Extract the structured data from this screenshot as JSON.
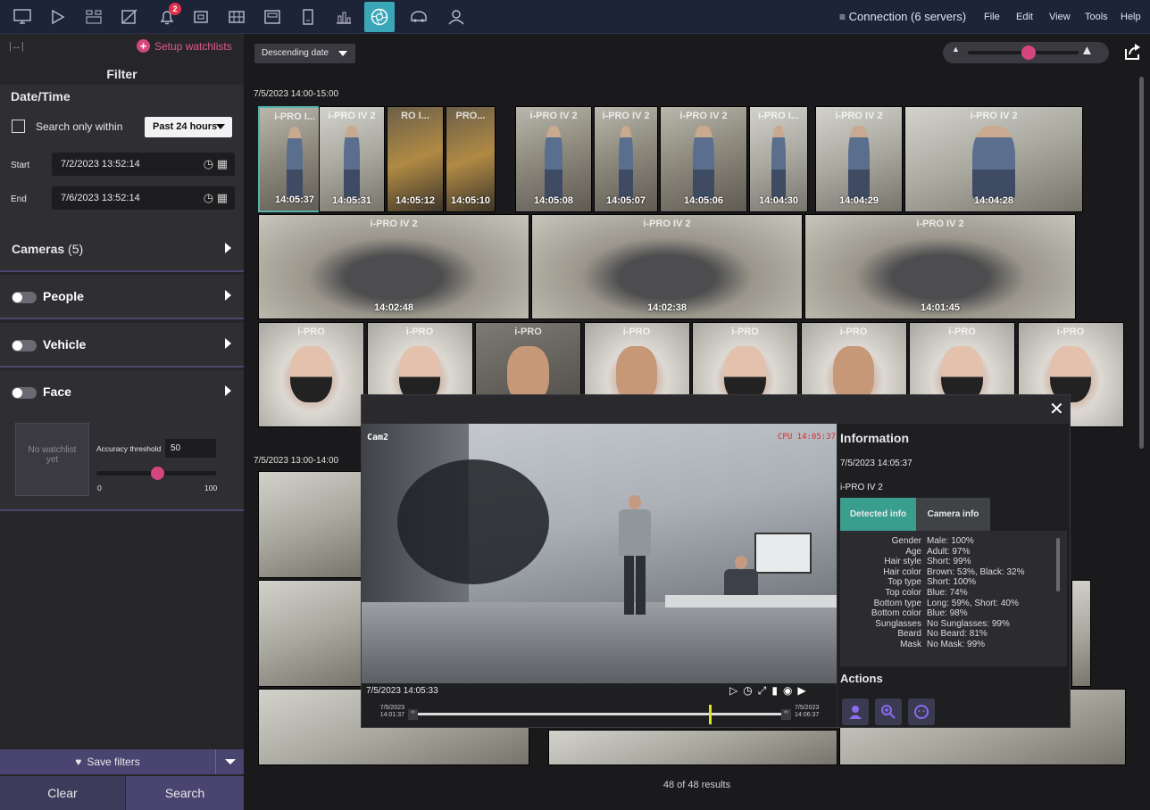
{
  "topbar": {
    "notification_count": "2",
    "connection": "Connection (6 servers)",
    "menus": [
      "File",
      "Edit",
      "View",
      "Tools",
      "Help"
    ]
  },
  "sidebar": {
    "setup_watchlists": "Setup watchlists",
    "filter_title": "Filter",
    "datetime_title": "Date/Time",
    "search_only_within": "Search only within",
    "range_option": "Past 24 hours",
    "start_label": "Start",
    "start_value": "7/2/2023 13:52:14",
    "end_label": "End",
    "end_value": "7/6/2023 13:52:14",
    "cameras_title": "Cameras",
    "cameras_count": "(5)",
    "people_title": "People",
    "vehicle_title": "Vehicle",
    "face_title": "Face",
    "no_watchlist": "No watchlist yet",
    "accuracy_label": "Accuracy threshold",
    "accuracy_value": "50",
    "slider_min": "0",
    "slider_max": "100",
    "save_filters": "Save filters",
    "clear": "Clear",
    "search": "Search"
  },
  "main": {
    "sort_option": "Descending date",
    "zoom_level": 0.55,
    "group1_label": "7/5/2023 14:00-15:00",
    "group2_label": "7/5/2023 13:00-14:00",
    "row1": [
      {
        "cam": "i-PRO I...",
        "time": "14:05:37"
      },
      {
        "cam": "i-PRO IV 2",
        "time": "14:05:31"
      },
      {
        "cam": "RO I...",
        "time": "14:05:12"
      },
      {
        "cam": "PRO...",
        "time": "14:05:10"
      },
      {
        "cam": "i-PRO IV 2",
        "time": "14:05:08"
      },
      {
        "cam": "i-PRO IV 2",
        "time": "14:05:07"
      },
      {
        "cam": "i-PRO IV 2",
        "time": "14:05:06"
      },
      {
        "cam": "i-PRO I...",
        "time": "14:04:30"
      },
      {
        "cam": "i-PRO IV 2",
        "time": "14:04:29"
      },
      {
        "cam": "i-PRO IV 2",
        "time": "14:04:28"
      }
    ],
    "row2": [
      {
        "cam": "i-PRO IV 2",
        "time": "14:02:48"
      },
      {
        "cam": "i-PRO IV 2",
        "time": "14:02:38"
      },
      {
        "cam": "i-PRO IV 2",
        "time": "14:01:45"
      }
    ],
    "row3_cam": "i-PRO",
    "results": "48 of 48 results"
  },
  "modal": {
    "cam_label": "Cam2",
    "overlay_tag": "CPU 14:05:37",
    "info_title": "Information",
    "info_datetime": "7/5/2023 14:05:37",
    "info_camera": "i-PRO IV 2",
    "tab_detected": "Detected info",
    "tab_camera": "Camera info",
    "attributes": [
      {
        "k": "Gender",
        "v": "Male: 100%"
      },
      {
        "k": "Age",
        "v": "Adult: 97%"
      },
      {
        "k": "Hair style",
        "v": "Short: 99%"
      },
      {
        "k": "Hair color",
        "v": "Brown: 53%, Black: 32%"
      },
      {
        "k": "Top type",
        "v": "Short: 100%"
      },
      {
        "k": "Top color",
        "v": "Blue: 74%"
      },
      {
        "k": "Bottom type",
        "v": "Long: 59%, Short: 40%"
      },
      {
        "k": "Bottom color",
        "v": "Blue: 98%"
      },
      {
        "k": "Sunglasses",
        "v": "No Sunglasses: 99%"
      },
      {
        "k": "Beard",
        "v": "No Beard: 81%"
      },
      {
        "k": "Mask",
        "v": "No Mask: 99%"
      }
    ],
    "actions_title": "Actions",
    "playback_time": "7/5/2023 14:05:33",
    "range_start_date": "7/5/2023",
    "range_start_time": "14:01:37",
    "range_end_date": "7/5/2023",
    "range_end_time": "14:06:37",
    "playhead_fraction": 0.8
  }
}
